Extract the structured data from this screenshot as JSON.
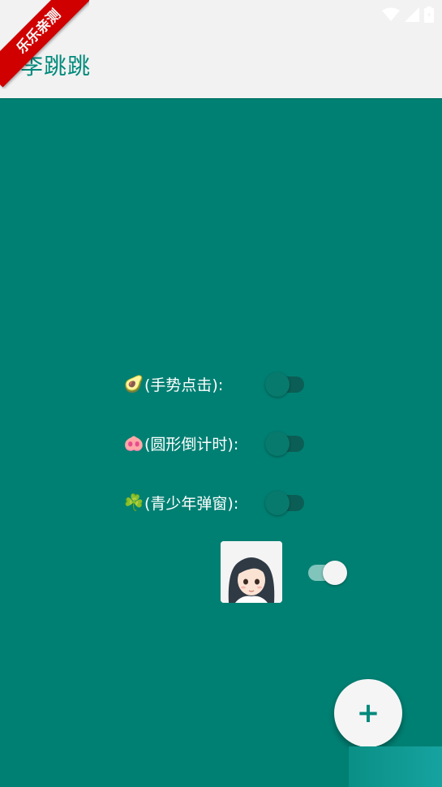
{
  "ribbon": {
    "text": "乐乐亲测"
  },
  "appbar": {
    "title": "李跳跳"
  },
  "options": [
    {
      "emoji": "🥑",
      "label": "(手势点击):",
      "enabled": false
    },
    {
      "emoji": "🐽",
      "label": "(圆形倒计时):",
      "enabled": false
    },
    {
      "emoji": "☘️",
      "label": "(青少年弹窗):",
      "enabled": false
    }
  ],
  "avatar_toggle": {
    "enabled": true
  },
  "fab": {
    "label": "+"
  },
  "colors": {
    "accent": "#00897b",
    "background": "#008073",
    "appbar": "#f2f2f2",
    "ribbon": "#d00000"
  }
}
